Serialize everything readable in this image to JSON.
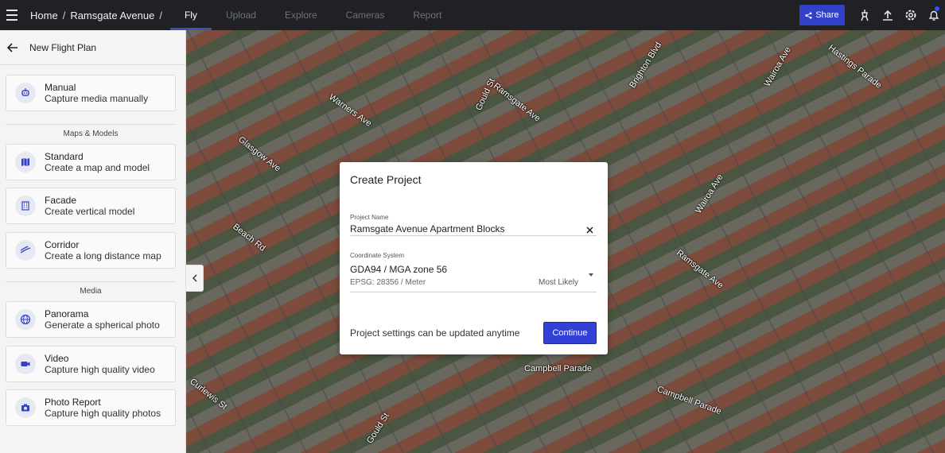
{
  "header": {
    "breadcrumb": [
      "Home",
      "Ramsgate Avenue"
    ],
    "breadcrumb_sep": "/",
    "tabs": [
      "Fly",
      "Upload",
      "Explore",
      "Cameras",
      "Report"
    ],
    "active_tab": "Fly",
    "share_label": "Share",
    "icons": [
      "menu-icon",
      "share-icon",
      "drone-icon",
      "upload-icon",
      "settings-icon",
      "notification-bell-icon"
    ],
    "accent_color": "#3340c9"
  },
  "panel": {
    "title": "New Flight Plan",
    "manual": {
      "title": "Manual",
      "subtitle": "Capture media manually",
      "icon": "drone-icon"
    },
    "section_maps": "Maps & Models",
    "maps": [
      {
        "title": "Standard",
        "subtitle": "Create a map and model",
        "icon": "map-icon"
      },
      {
        "title": "Facade",
        "subtitle": "Create vertical model",
        "icon": "facade-icon"
      },
      {
        "title": "Corridor",
        "subtitle": "Create a long distance map",
        "icon": "corridor-icon"
      }
    ],
    "section_media": "Media",
    "media": [
      {
        "title": "Panorama",
        "subtitle": "Generate a spherical photo",
        "icon": "globe-icon"
      },
      {
        "title": "Video",
        "subtitle": "Capture high quality video",
        "icon": "video-camera-icon"
      },
      {
        "title": "Photo Report",
        "subtitle": "Capture high quality photos",
        "icon": "camera-icon"
      }
    ]
  },
  "map": {
    "streets": [
      "Brighton Blvd",
      "Wairoa Ave",
      "Hastings Parade",
      "Warners Ave",
      "Gould St",
      "Ramsgate Ave",
      "Glasgow Ave",
      "Beach Rd",
      "Campbell Parade",
      "Curlewis St"
    ]
  },
  "modal": {
    "title": "Create Project",
    "name_label": "Project Name",
    "name_value": "Ramsgate Avenue Apartment Blocks",
    "coord_label": "Coordinate System",
    "coord_value": "GDA94 / MGA zone 56",
    "coord_detail": "EPSG: 28356 / Meter",
    "coord_hint": "Most Likely",
    "note": "Project settings can be updated anytime",
    "continue_label": "Continue"
  }
}
